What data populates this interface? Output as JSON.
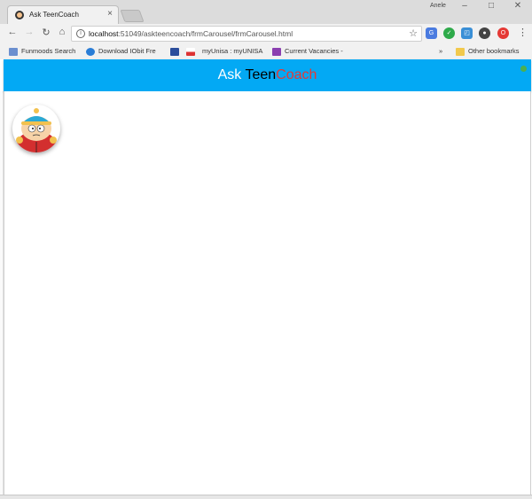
{
  "browser": {
    "tab_title": "Ask TeenCoach",
    "profile_name": "Anele",
    "url_host": "localhost",
    "url_rest": ":51049/askteencoach/frmCarousel/frmCarousel.html",
    "bookmarks": [
      {
        "label": "Funmoods Search",
        "icon": "funmoods-icon",
        "color": "#6b8fcf"
      },
      {
        "label": "Download IObit Fre",
        "icon": "iobit-icon",
        "color": "#2a7dd6"
      },
      {
        "label": "",
        "icon": "flag-icon",
        "color": "#d33"
      },
      {
        "label": "myUnisa : myUNISA",
        "icon": "unisa-icon",
        "color": "#6a3fa0"
      },
      {
        "label": "Current Vacancies - ",
        "icon": "vacancies-icon",
        "color": "#8a3fb0"
      }
    ],
    "overflow": "»",
    "other_bookmarks": "Other bookmarks"
  },
  "app": {
    "title_part1": "Ask ",
    "title_part2": "Teen",
    "title_part3": "Coach",
    "avatar_icon": "cartman-avatar-icon",
    "colors": {
      "header": "#03a9f4",
      "accent_red": "#e53935",
      "status_green": "#4caf50"
    }
  }
}
